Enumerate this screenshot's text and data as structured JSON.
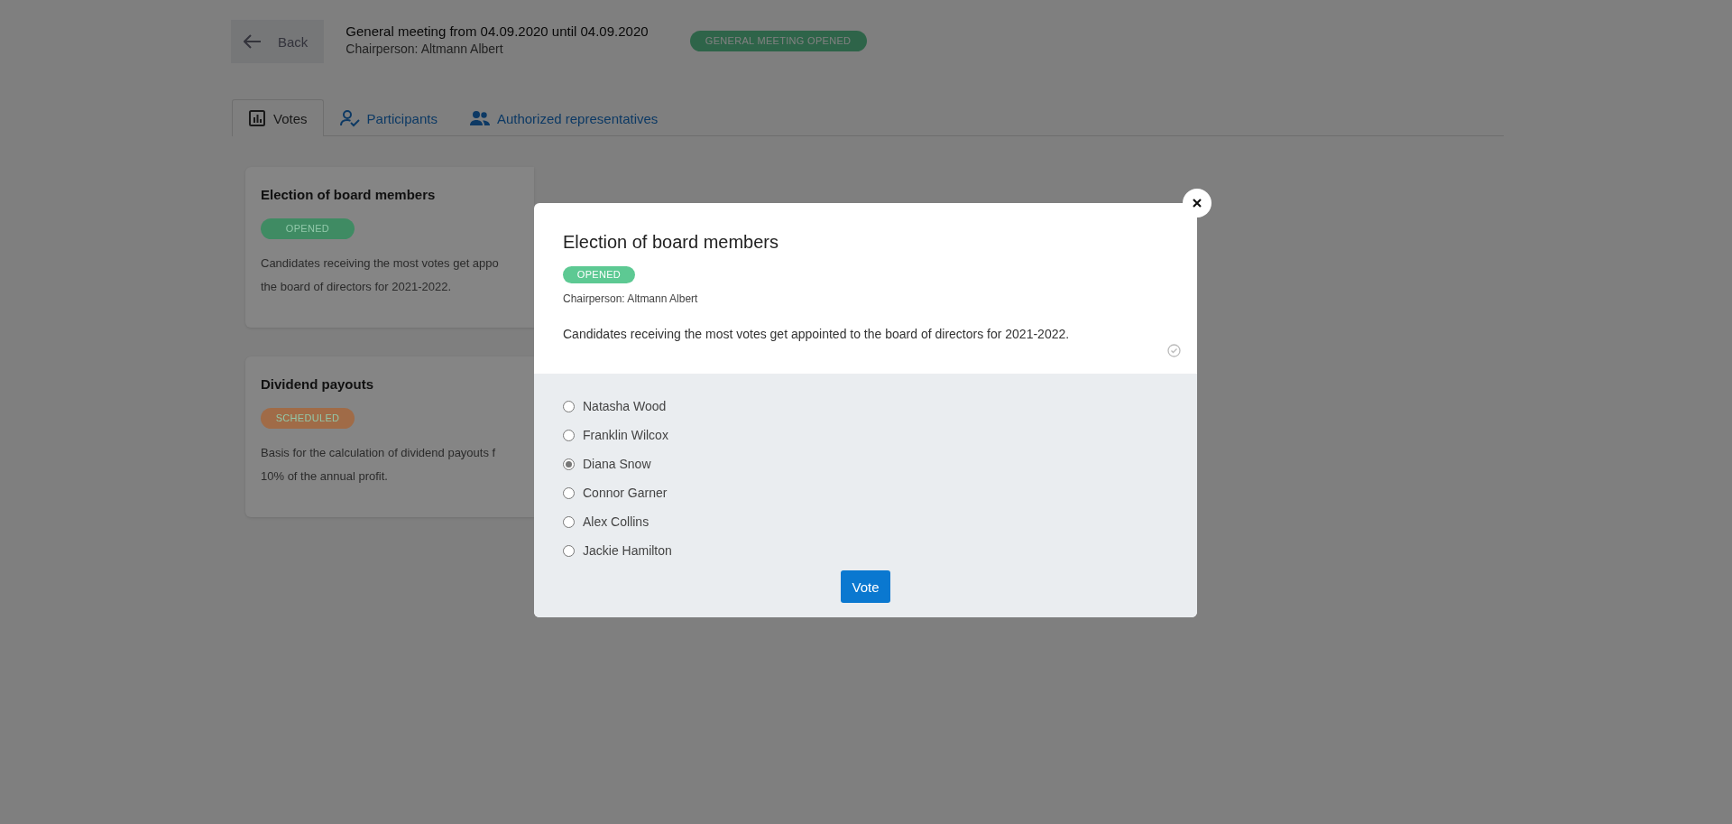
{
  "header": {
    "back_label": "Back",
    "title": "General meeting from 04.09.2020 until 04.09.2020",
    "chairperson": "Chairperson: Altmann Albert",
    "status": "GENERAL MEETING OPENED"
  },
  "tabs": [
    {
      "label": "Votes",
      "kind": "chart",
      "selected": true
    },
    {
      "label": "Participants",
      "kind": "person-check",
      "selected": false
    },
    {
      "label": "Authorized representatives",
      "kind": "people",
      "selected": false
    }
  ],
  "cards": [
    {
      "title": "Election of board members",
      "status": "OPENED",
      "color": "#3f8b63",
      "lines": [
        "Candidates receiving the most votes get appo",
        "the board of directors for 2021-2022."
      ]
    },
    {
      "title": "Dividend payouts",
      "status": "SCHEDULED",
      "color": "#a06b47",
      "lines": [
        "Basis for the calculation of dividend payouts f",
        "10% of the annual profit."
      ]
    }
  ],
  "modal": {
    "title": "Election of board members",
    "status": "OPENED",
    "chairperson": "Chairperson: Altmann Albert",
    "description": "Candidates receiving the most votes get appointed to the board of directors for 2021-2022.",
    "options": [
      {
        "label": "Natasha Wood",
        "selected": false
      },
      {
        "label": "Franklin Wilcox",
        "selected": false
      },
      {
        "label": "Diana Snow",
        "selected": true
      },
      {
        "label": "Connor Garner",
        "selected": false
      },
      {
        "label": "Alex Collins",
        "selected": false
      },
      {
        "label": "Jackie Hamilton",
        "selected": false
      }
    ],
    "button": "Vote"
  }
}
